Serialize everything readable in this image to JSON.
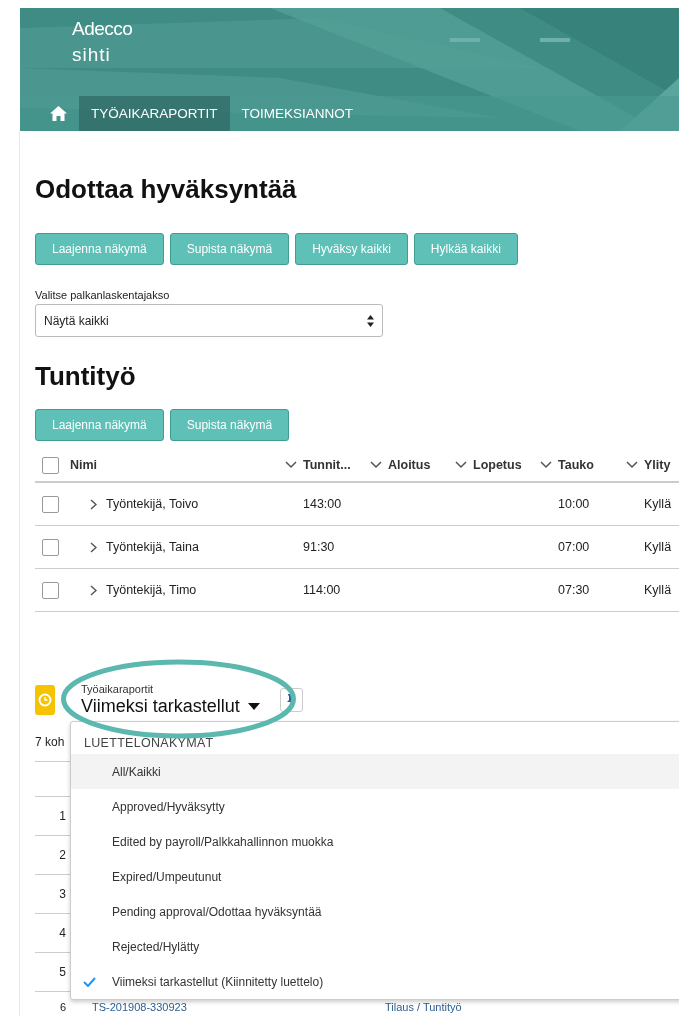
{
  "header": {
    "logo_top": "Adecco",
    "logo_bottom": "sihti",
    "nav": [
      {
        "kind": "home",
        "selected": false
      },
      {
        "kind": "tab",
        "label": "TYÖAIKARAPORTIT",
        "selected": true
      },
      {
        "kind": "tab",
        "label": "TOIMEKSIANNOT",
        "selected": false
      }
    ]
  },
  "approval": {
    "title": "Odottaa hyväksyntää",
    "buttons": [
      "Laajenna näkymä",
      "Supista näkymä",
      "Hyväksy kaikki",
      "Hylkää kaikki"
    ],
    "period": {
      "label": "Valitse palkanlaskentajakso",
      "value": "Näytä kaikki"
    }
  },
  "hourly": {
    "title": "Tuntityö",
    "buttons": [
      "Laajenna näkymä",
      "Supista näkymä"
    ],
    "table": {
      "all_checked": false,
      "columns": [
        {
          "label": "Nimi",
          "has_menu": true
        },
        {
          "label": "Tunnit...",
          "has_menu": true
        },
        {
          "label": "Aloitus",
          "has_menu": true
        },
        {
          "label": "Lopetus",
          "has_menu": true
        },
        {
          "label": "Tauko",
          "has_menu": true
        },
        {
          "label": "Ylity",
          "has_menu": false
        }
      ],
      "rows": [
        {
          "checked": false,
          "expanded": false,
          "name": "Työntekijä, Toivo",
          "hours": "143:00",
          "break": "10:00",
          "column_6": "Kyllä"
        },
        {
          "checked": false,
          "expanded": false,
          "name": "Työntekijä, Taina",
          "hours": "91:30",
          "break": "07:00",
          "column_6": "Kyllä"
        },
        {
          "checked": false,
          "expanded": false,
          "name": "Työntekijä, Timo",
          "hours": "114:00",
          "break": "07:30",
          "column_6": "Kyllä"
        }
      ]
    }
  },
  "reports": {
    "object_label": "Työaikaraportit",
    "view_name": "Viimeksi tarkastellut",
    "count": "7 koh",
    "row_numbers": [
      "1",
      "2",
      "3",
      "4",
      "5",
      "6"
    ],
    "last_row": {
      "name": "TS-201908-330923",
      "column_3": "Tilaus / Tuntityö"
    },
    "menu": {
      "heading": "LUETTELONÄKYMÄT",
      "items": [
        {
          "label": "All/Kaikki",
          "hovered": true,
          "selected": false
        },
        {
          "label": "Approved/Hyväksytty",
          "hovered": false,
          "selected": false
        },
        {
          "label": "Edited by payroll/Palkkahallinnon muokka",
          "hovered": false,
          "selected": false
        },
        {
          "label": "Expired/Umpeutunut",
          "hovered": false,
          "selected": false
        },
        {
          "label": "Pending approval/Odottaa hyväksyntää",
          "hovered": false,
          "selected": false
        },
        {
          "label": "Rejected/Hylätty",
          "hovered": false,
          "selected": false
        },
        {
          "label": "Viimeksi tarkastellut (Kiinnitetty luettelo)",
          "hovered": false,
          "selected": true
        }
      ]
    }
  }
}
